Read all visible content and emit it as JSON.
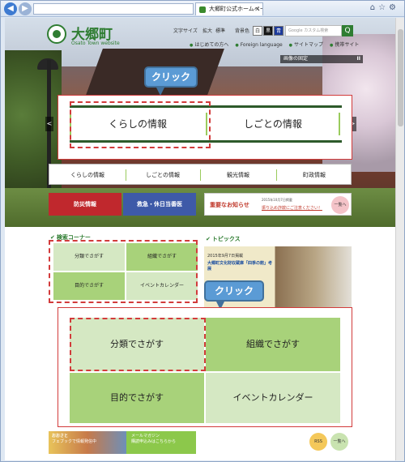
{
  "browser": {
    "address_text": "",
    "tab_title": "大郷町公式ホームページ",
    "nav_back": "◀",
    "nav_forward": "▶"
  },
  "site": {
    "logo_title": "大郷町",
    "logo_subtitle": "Osato Town website",
    "util_fontsize": "文字サイズ",
    "util_large": "拡大",
    "util_standard": "標準",
    "util_color": "背景色",
    "util_white": "白",
    "util_black": "黒",
    "util_blue": "青",
    "search_placeholder": "Google カスタム検索",
    "search_btn": "Q",
    "sublinks": [
      "はじめての方へ",
      "Foreign language",
      "サイトマップ",
      "携帯サイト"
    ]
  },
  "hero": {
    "pause_label": "画像の固定",
    "pause_icon": "II",
    "prev": "<",
    "next": ">"
  },
  "callout1": {
    "label": "クリック"
  },
  "callout2": {
    "label": "クリック"
  },
  "zoom_menu": {
    "left": "くらしの情報",
    "right": "しごとの情報"
  },
  "navbar": {
    "items": [
      "くらしの情報",
      "しごとの情報",
      "観光情報",
      "町政情報"
    ]
  },
  "alerts": {
    "disaster": "防災情報",
    "emergency": "救急・休日当番医",
    "notice_title": "重要なお知らせ",
    "notice_date": "2015年10月7日掲載",
    "notice_text": "振り込め詐欺にご注意ください！",
    "notice_list": "一覧へ"
  },
  "search_corner": {
    "title": "検索コーナー",
    "items": [
      "分類でさがす",
      "組織でさがす",
      "目的でさがす",
      "イベントカレンダー"
    ]
  },
  "topics": {
    "title": "トピックス",
    "date": "2015年9月7日掲載",
    "headline": "大郷町文化財収蔵庫「四季の館」考展"
  },
  "zoom_search": {
    "items": [
      "分類でさがす",
      "組織でさがす",
      "目的でさがす",
      "イベントカレンダー"
    ]
  },
  "bottom": {
    "banner_text": "おおさと",
    "banner_sub": "フェブックで情報発信中",
    "mail_text": "メールマガジン",
    "mail_sub": "購読申込みはこちらから",
    "rss": "RSS",
    "list": "一覧へ"
  },
  "colors": {
    "brand_green": "#2f7d32",
    "light_green": "#9acb5d",
    "pale_green": "#d5e8c3",
    "callout_red": "#d23b3b",
    "callout_blue": "#5b9bd5",
    "disaster_red": "#c0282d",
    "emergency_blue": "#3e5aa8"
  }
}
